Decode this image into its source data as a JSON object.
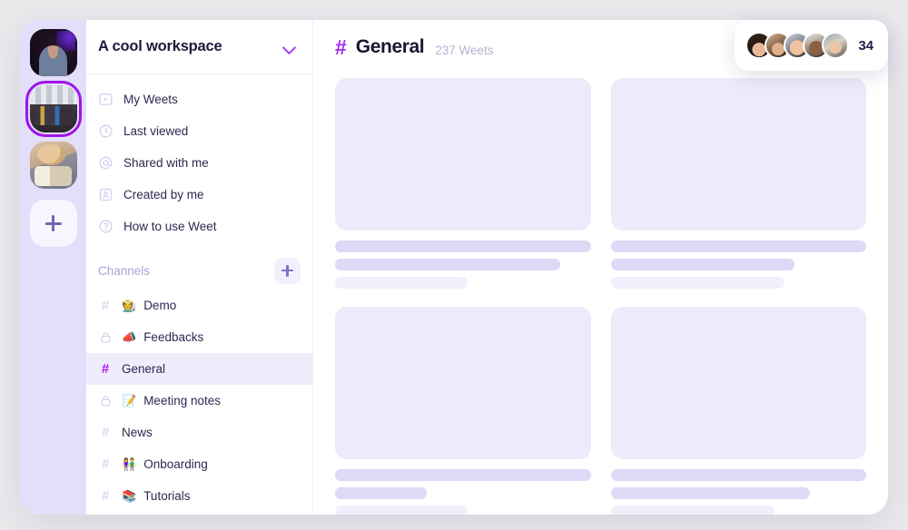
{
  "colors": {
    "accent": "#a12df0",
    "accent_bright": "#b715f5",
    "rail_bg": "#e3dffa",
    "page_bg": "#e9e9ec",
    "active_row": "#efedfb",
    "skeleton_thumb": "#edebfb",
    "skeleton_line": "#ddd9f7",
    "text_primary": "#1d1b3a",
    "text_muted": "#a9a4d6",
    "selected_ring": "#a014e8"
  },
  "rail": {
    "workspaces": [
      {
        "name": "workspace-1",
        "selected": false
      },
      {
        "name": "workspace-2",
        "selected": true
      },
      {
        "name": "workspace-3",
        "selected": false
      }
    ],
    "add_button": {
      "icon": "plus-icon",
      "label": "+"
    }
  },
  "sidebar": {
    "workspace_title": "A cool workspace",
    "workspace_chevron_icon": "chevron-down-icon",
    "quick_nav": [
      {
        "label": "My Weets",
        "icon": "video-square-icon"
      },
      {
        "label": "Last viewed",
        "icon": "clock-icon"
      },
      {
        "label": "Shared with me",
        "icon": "at-sign-icon"
      },
      {
        "label": "Created by me",
        "icon": "user-square-icon"
      },
      {
        "label": "How to use Weet",
        "icon": "question-circle-icon"
      }
    ],
    "channels_title": "Channels",
    "add_channel_icon": "plus-icon",
    "channels": [
      {
        "label": "Demo",
        "emoji": "🧑‍🌾",
        "mark": "#",
        "private": false,
        "active": false
      },
      {
        "label": "Feedbacks",
        "emoji": "📣",
        "mark": "lock",
        "private": true,
        "active": false
      },
      {
        "label": "General",
        "emoji": "",
        "mark": "#",
        "private": false,
        "active": true
      },
      {
        "label": "Meeting notes",
        "emoji": "📝",
        "mark": "lock",
        "private": true,
        "active": false
      },
      {
        "label": "News",
        "emoji": "",
        "mark": "#",
        "private": false,
        "active": false
      },
      {
        "label": "Onboarding",
        "emoji": "👫",
        "mark": "#",
        "private": false,
        "active": false
      },
      {
        "label": "Tutorials",
        "emoji": "📚",
        "mark": "#",
        "private": false,
        "active": false
      }
    ]
  },
  "main": {
    "channel_hash": "#",
    "channel_name": "General",
    "channel_count": "237 Weets",
    "cards": [
      {
        "lines": [
          "long",
          "medium",
          "short-faint"
        ]
      },
      {
        "lines": [
          "long",
          "medium",
          "short-faint"
        ]
      },
      {
        "lines": [
          "long",
          "short",
          "short-faint"
        ]
      },
      {
        "lines": [
          "long",
          "medium",
          "short-faint"
        ]
      }
    ]
  },
  "presence": {
    "avatars": [
      "member-1",
      "member-2",
      "member-3",
      "member-4",
      "member-5"
    ],
    "count": "34"
  }
}
